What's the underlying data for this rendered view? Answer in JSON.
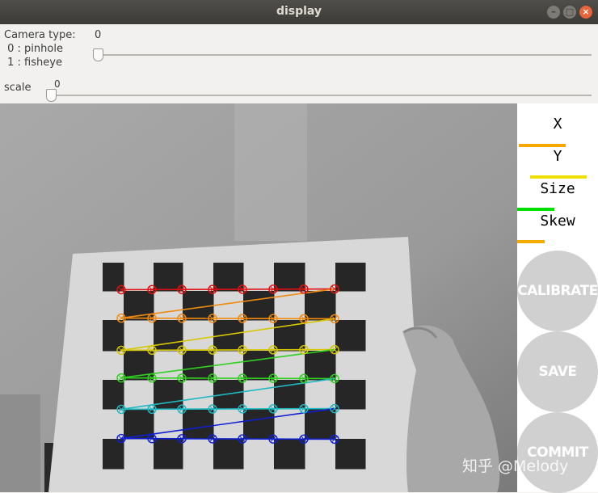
{
  "window": {
    "title": "display"
  },
  "controls": {
    "camera_type_label": "Camera type:",
    "camera_type_value": "0",
    "option_pinhole": " 0 : pinhole",
    "option_fisheye": " 1 : fisheye",
    "camera_type_slider_fraction": 0,
    "scale_label": "scale",
    "scale_value": "0",
    "scale_slider_fraction": 0
  },
  "side_panel": {
    "x_label": "X",
    "x_progress": 0.58,
    "x_color": "#f5a800",
    "y_label": "Y",
    "y_progress": 0.7,
    "y_color": "#f0e000",
    "size_label": "Size",
    "size_progress": 0.46,
    "size_color": "#00e000",
    "skew_label": "Skew",
    "skew_progress": 0.34,
    "skew_color": "#f5a800",
    "calibrate_label": "CALIBRATE",
    "save_label": "SAVE",
    "commit_label": "COMMIT"
  },
  "corner_colors": [
    "#e01010",
    "#f08a10",
    "#d6c800",
    "#30d020",
    "#20b8c0",
    "#1020d0"
  ],
  "watermark": "知乎 @Melody"
}
